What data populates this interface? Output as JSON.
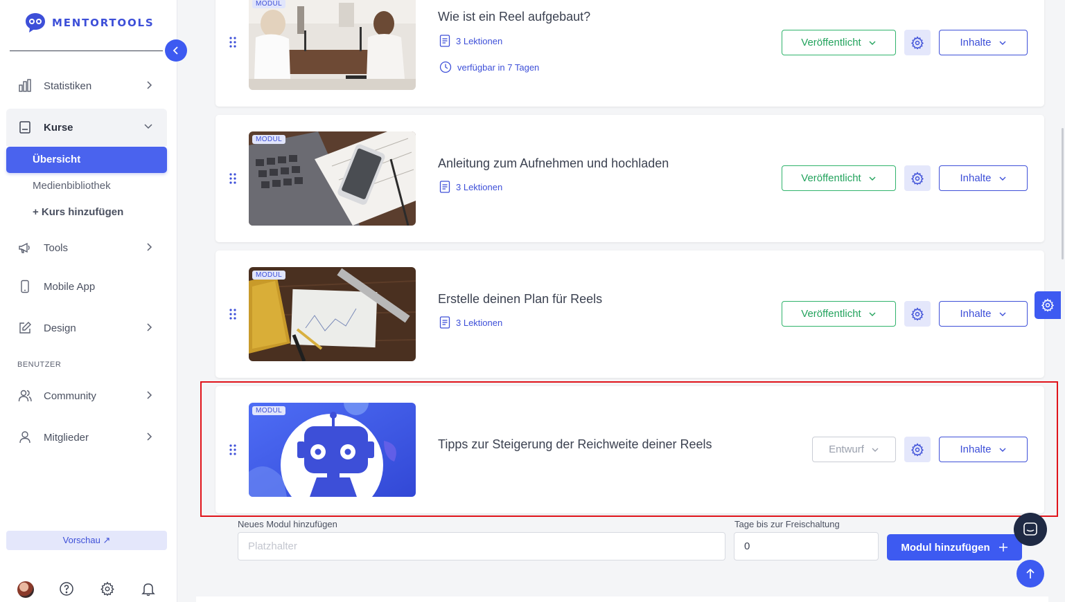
{
  "brand": {
    "name": "MENTORTOOLS",
    "color": "#3d4fd8",
    "accent": "#3d5af1"
  },
  "sidebar": {
    "nav": [
      {
        "label": "Statistiken",
        "icon": "bar-chart-icon"
      },
      {
        "label": "Kurse",
        "icon": "book-icon"
      },
      {
        "label": "Tools",
        "icon": "megaphone-icon"
      },
      {
        "label": "Mobile App",
        "icon": "phone-icon"
      },
      {
        "label": "Design",
        "icon": "edit-icon"
      }
    ],
    "kurse_sub": {
      "active": "Übersicht",
      "media": "Medienbibliothek",
      "add": "+ Kurs hinzufügen"
    },
    "section_users": "BENUTZER",
    "user_nav": [
      {
        "label": "Community",
        "icon": "users-icon"
      },
      {
        "label": "Mitglieder",
        "icon": "user-icon"
      }
    ],
    "preview": "Vorschau ↗"
  },
  "modules": [
    {
      "badge": "MODUL",
      "title": "Wie ist ein Reel aufgebaut?",
      "lessons": "3 Lektionen",
      "availability": "verfügbar in 7 Tagen",
      "status": "Veröffentlicht",
      "content": "Inhalte"
    },
    {
      "badge": "MODUL",
      "title": "Anleitung zum Aufnehmen und hochladen",
      "lessons": "3 Lektionen",
      "status": "Veröffentlicht",
      "content": "Inhalte"
    },
    {
      "badge": "MODUL",
      "title": "Erstelle deinen Plan für Reels",
      "lessons": "3 Lektionen",
      "status": "Veröffentlicht",
      "content": "Inhalte"
    },
    {
      "badge": "MODUL",
      "title": "Tipps zur Steigerung der Reichweite deiner Reels",
      "status": "Entwurf",
      "content": "Inhalte"
    }
  ],
  "form": {
    "module_label": "Neues Modul hinzufügen",
    "module_placeholder": "Platzhalter",
    "days_label": "Tage bis zur Freischaltung",
    "days_value": "0",
    "add_button": "Modul hinzufügen"
  }
}
